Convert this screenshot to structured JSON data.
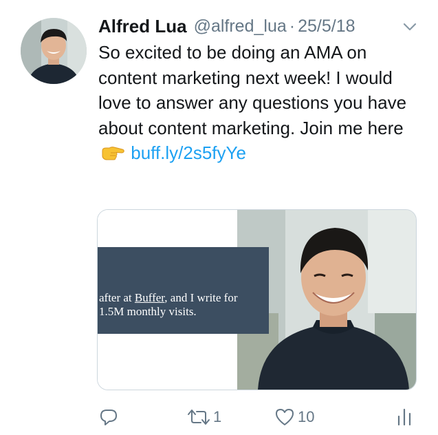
{
  "tweet": {
    "author_name": "Alfred Lua",
    "handle": "@alfred_lua",
    "separator": "·",
    "date": "25/5/18",
    "text_main": "So excited to be doing an AMA on content marketing next week! I would love to answer any questions you have about content marketing. Join me here",
    "link_text": "buff.ly/2s5fyYe"
  },
  "card": {
    "line1_prefix": "after at ",
    "line1_link": "Buffer",
    "line1_suffix": ", and I write for",
    "line2": "1.5M monthly visits."
  },
  "actions": {
    "reply_count": "",
    "retweet_count": "1",
    "like_count": "10"
  },
  "icons": {
    "reply": "reply-icon",
    "retweet": "retweet-icon",
    "like": "heart-icon",
    "analytics": "analytics-icon",
    "caret": "chevron-down-icon",
    "emoji": "pointing-hand-emoji"
  },
  "colors": {
    "link": "#1da1f2",
    "secondary": "#657786",
    "banner": "#3c4e61"
  }
}
